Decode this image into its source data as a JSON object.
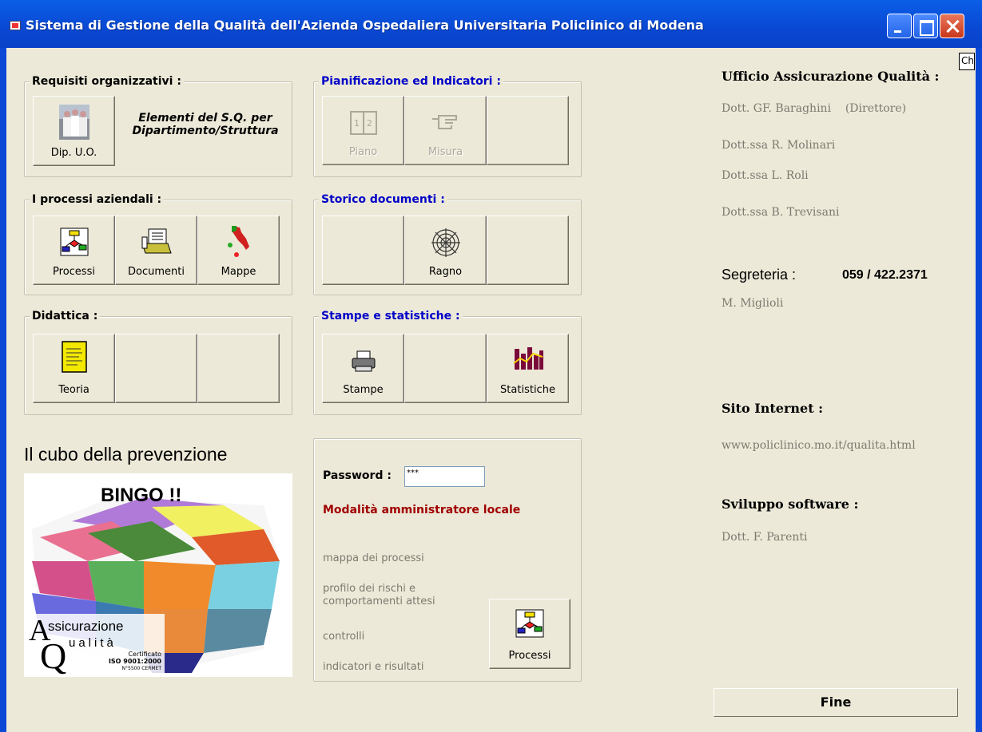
{
  "window": {
    "title": "Sistema di Gestione della Qualità dell'Azienda Ospedaliera Universitaria Policlinico di Modena",
    "corner_tag": "Ch"
  },
  "req": {
    "legend": "Requisiti organizzativi :",
    "btn": "Dip. U.O.",
    "desc": "Elementi del S.Q. per Dipartimento/Struttura"
  },
  "pian": {
    "legend": "Pianificazione ed Indicatori :",
    "b1": "Piano",
    "b2": "Misura"
  },
  "proc": {
    "legend": "I processi aziendali :",
    "b1": "Processi",
    "b2": "Documenti",
    "b3": "Mappe"
  },
  "storico": {
    "legend": "Storico documenti :",
    "b2": "Ragno"
  },
  "didattica": {
    "legend": "Didattica :",
    "b1": "Teoria"
  },
  "stampe": {
    "legend": "Stampe e statistiche :",
    "b1": "Stampe",
    "b3": "Statistiche"
  },
  "cubo": {
    "title": "Il cubo della prevenzione",
    "bingo": "BINGO !!",
    "logo1": "ssicurazione",
    "logo2": "ualità",
    "cert1": "Certificato",
    "cert2": "ISO 9001:2000",
    "cert3": "N°5500 CERMET"
  },
  "admin": {
    "password_label": "Password :",
    "password_value": "***",
    "mode": "Modalità amministratore locale",
    "l1": "mappa dei processi",
    "l2a": "profilo dei rischi e",
    "l2b": "comportamenti attesi",
    "l3": "controlli",
    "l4": "indicatori e risultati",
    "btn": "Processi"
  },
  "info": {
    "ufficio": "Ufficio Assicurazione Qualità :",
    "p1": "Dott. GF. Baraghini    (Direttore)",
    "p2": "Dott.ssa R. Molinari",
    "p3": "Dott.ssa L. Roli",
    "p4": "Dott.ssa B. Trevisani",
    "segreteria": "Segreteria :",
    "phone": "059 / 422.2371",
    "segr_name": "M. Miglioli",
    "sito": "Sito Internet :",
    "url": "www.policlinico.mo.it/qualita.html",
    "sviluppo": "Sviluppo software :",
    "dev": "Dott. F. Parenti"
  },
  "fine": "Fine"
}
